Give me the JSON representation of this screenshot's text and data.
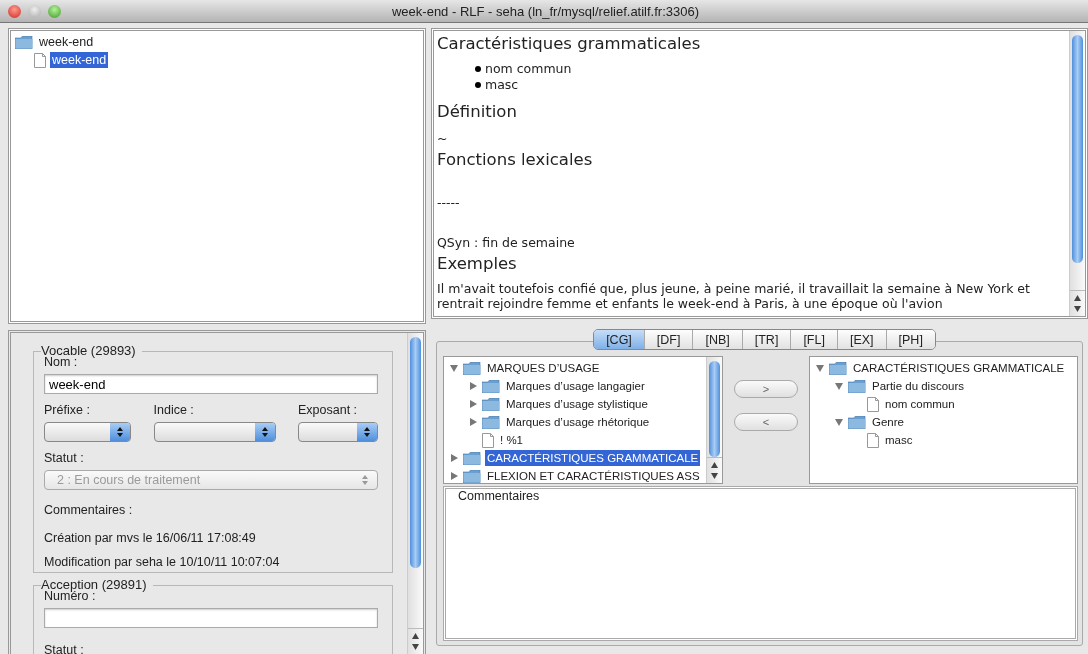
{
  "window": {
    "title": "week-end - RLF - seha (ln_fr/mysql/relief.atilf.fr:3306)"
  },
  "entry_tree": [
    {
      "label": "week-end",
      "kind": "folder",
      "selected": false,
      "children": [
        {
          "label": "week-end",
          "kind": "leaf",
          "selected": true
        }
      ]
    }
  ],
  "vocable": {
    "legend": "Vocable (29893)",
    "name_label": "Nom :",
    "name_value": "week-end",
    "combos": [
      {
        "label": "Préfixe :"
      },
      {
        "label": "Indice :"
      },
      {
        "label": "Exposant :"
      }
    ],
    "status_label": "Statut :",
    "status_value": "2 : En cours de traitement",
    "status_disabled": true,
    "comments_label": "Commentaires :",
    "created": "Création par mvs le 16/06/11 17:08:49",
    "modified": "Modification par seha le 10/10/11 10:07:04"
  },
  "acception": {
    "legend": "Acception (29891)",
    "number_label": "Numéro :",
    "status_label": "Statut :"
  },
  "document": [
    {
      "kind": "heading",
      "text": "Caractéristiques grammaticales"
    },
    {
      "kind": "bullet",
      "text": "nom commun"
    },
    {
      "kind": "bullet",
      "text": "masc"
    },
    {
      "kind": "heading",
      "text": "Définition"
    },
    {
      "kind": "text",
      "text": "~"
    },
    {
      "kind": "heading",
      "text": "Fonctions lexicales"
    },
    {
      "kind": "gap"
    },
    {
      "kind": "text",
      "text": "-----"
    },
    {
      "kind": "gap"
    },
    {
      "kind": "text",
      "text": "QSyn : fin de semaine"
    },
    {
      "kind": "heading",
      "text": "Exemples"
    },
    {
      "kind": "paragraph",
      "text": "Il m'avait toutefois confié que, plus jeune, à peine marié, il travaillait la semaine à New York et rentrait rejoindre femme et enfants le week-end à Paris, à une époque où l'avion"
    }
  ],
  "tabs": [
    {
      "label": "[CG]",
      "selected": true
    },
    {
      "label": "[DF]",
      "selected": false
    },
    {
      "label": "[NB]",
      "selected": false
    },
    {
      "label": "[TR]",
      "selected": false
    },
    {
      "label": "[FL]",
      "selected": false
    },
    {
      "label": "[EX]",
      "selected": false
    },
    {
      "label": "[PH]",
      "selected": false
    }
  ],
  "category_tree": [
    {
      "label": "MARQUES D’USAGE",
      "kind": "folder",
      "expanded": true,
      "selected": false,
      "children": [
        {
          "label": "Marques d’usage langagier",
          "kind": "folder",
          "expanded": false,
          "selected": false
        },
        {
          "label": "Marques d’usage stylistique",
          "kind": "folder",
          "expanded": false,
          "selected": false
        },
        {
          "label": "Marques d’usage rhétorique",
          "kind": "folder",
          "expanded": false,
          "selected": false
        },
        {
          "label": "! %1",
          "kind": "leaf",
          "selected": false
        }
      ]
    },
    {
      "label": "CARACTÉRISTIQUES GRAMMATICALE",
      "kind": "folder",
      "expanded": false,
      "selected": true
    },
    {
      "label": "FLEXION ET CARACTÉRISTIQUES ASS",
      "kind": "folder",
      "expanded": false,
      "selected": false
    }
  ],
  "transfer_buttons": [
    ">",
    "<"
  ],
  "chosen_tree": [
    {
      "label": "CARACTÉRISTIQUES GRAMMATICALE",
      "kind": "folder",
      "expanded": true,
      "selected": false,
      "children": [
        {
          "label": "Partie du discours",
          "kind": "folder",
          "expanded": true,
          "selected": false,
          "children": [
            {
              "label": "nom commun",
              "kind": "leaf",
              "selected": false
            }
          ]
        },
        {
          "label": "Genre",
          "kind": "folder",
          "expanded": true,
          "selected": false,
          "children": [
            {
              "label": "masc",
              "kind": "leaf",
              "selected": false
            }
          ]
        }
      ]
    }
  ],
  "comments": {
    "legend": "Commentaires"
  }
}
